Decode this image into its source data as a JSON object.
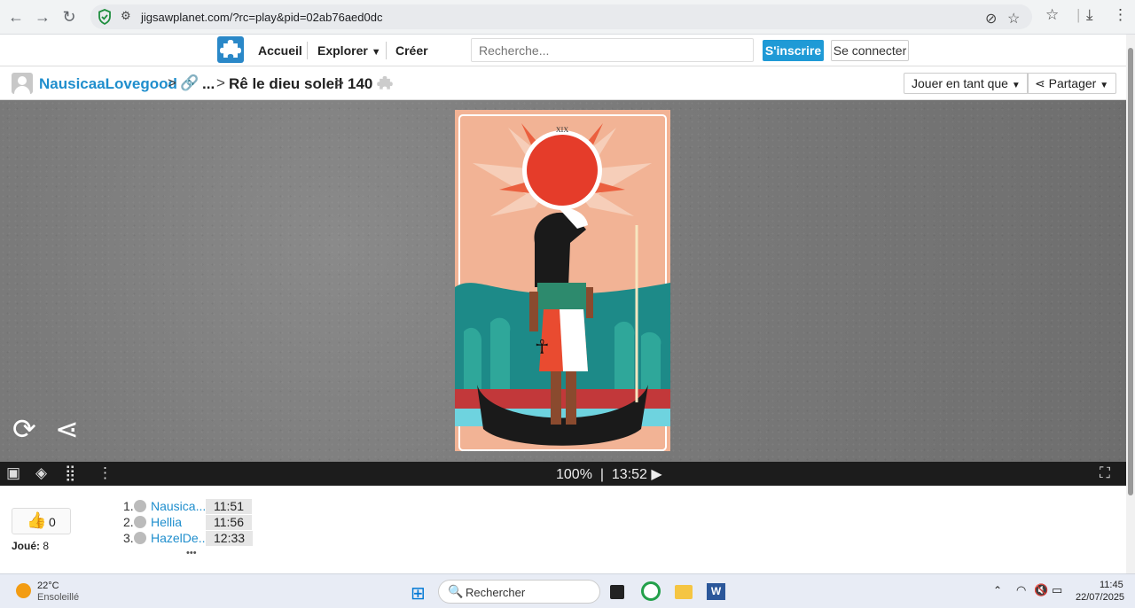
{
  "browser": {
    "url": "jigsawplanet.com/?rc=play&pid=02ab76aed0dc"
  },
  "header": {
    "nav_home": "Accueil",
    "nav_explore": "Explorer",
    "nav_create": "Créer",
    "search_placeholder": "Recherche...",
    "signup": "S'inscrire",
    "login": "Se connecter"
  },
  "breadcrumb": {
    "user": "NausicaaLovegood",
    "ellipsis": "...",
    "title": "Rê le dieu soleil",
    "pieces": "140",
    "play_as": "Jouer en tant que",
    "share": "Partager"
  },
  "toolbar": {
    "zoom": "100%",
    "separator": "|",
    "time": "13:52"
  },
  "stats": {
    "likes": "0",
    "played_label": "Joué:",
    "played_count": "8"
  },
  "scores": [
    {
      "rank": "1.",
      "name": "Nausica...",
      "time": "11:51"
    },
    {
      "rank": "2.",
      "name": "Hellia",
      "time": "11:56"
    },
    {
      "rank": "3.",
      "name": "HazelDe...",
      "time": "12:33"
    }
  ],
  "scores_more": "•••",
  "taskbar": {
    "temperature": "22°C",
    "weather": "Ensoleillé",
    "search": "Rechercher",
    "time": "11:45",
    "date": "22/07/2025"
  },
  "colors": {
    "accent": "#1f9ad6",
    "link": "#1f8ecd",
    "toolbar": "#1c1c1c"
  }
}
